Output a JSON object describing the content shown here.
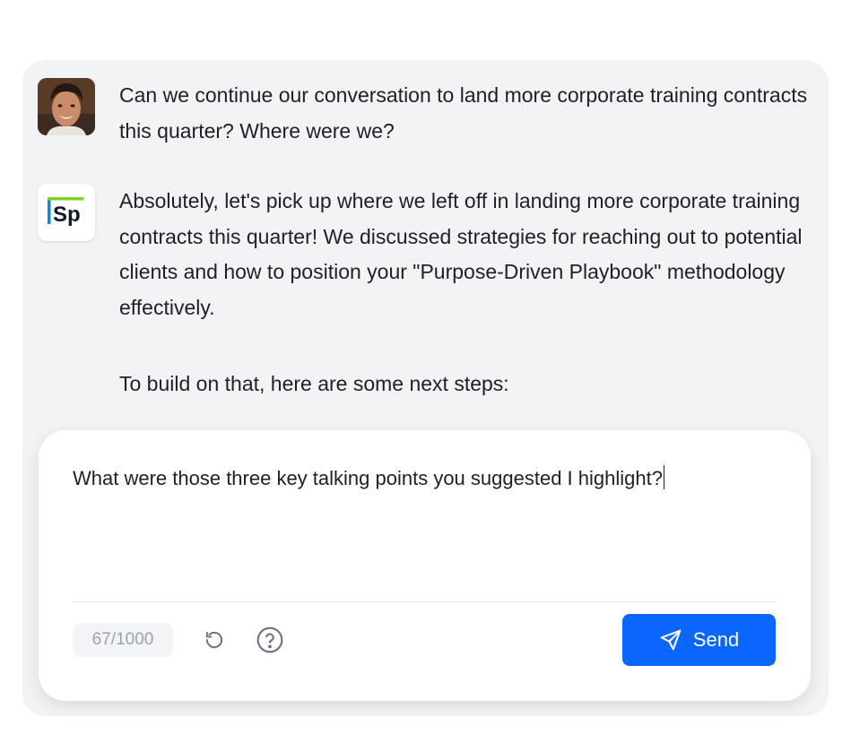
{
  "conversation": {
    "messages": [
      {
        "role": "user",
        "avatar_icon": "user-photo-avatar",
        "text": "Can we continue our conversation to land more corporate training contracts this quarter? Where were we?"
      },
      {
        "role": "assistant",
        "avatar_icon": "sp-logo",
        "logo_text": "Sp",
        "text": "Absolutely, let's pick up where we left off in landing more corporate training contracts this quarter! We discussed strategies for reaching out to potential clients and how to position your \"Purpose-Driven Playbook\" methodology effectively.",
        "text2": "To build on that, here are some next steps:"
      }
    ]
  },
  "composer": {
    "input_value": "What were those three key talking points you suggested I highlight?",
    "char_count": "67/1000",
    "reset_icon": "refresh-icon",
    "help_icon": "help-circle-icon",
    "send_label": "Send",
    "send_icon": "paper-plane-icon"
  },
  "colors": {
    "panel_bg": "#f2f3f5",
    "accent": "#0a66ff",
    "logo_green": "#7ed321",
    "logo_blue": "#0a8bd6"
  }
}
